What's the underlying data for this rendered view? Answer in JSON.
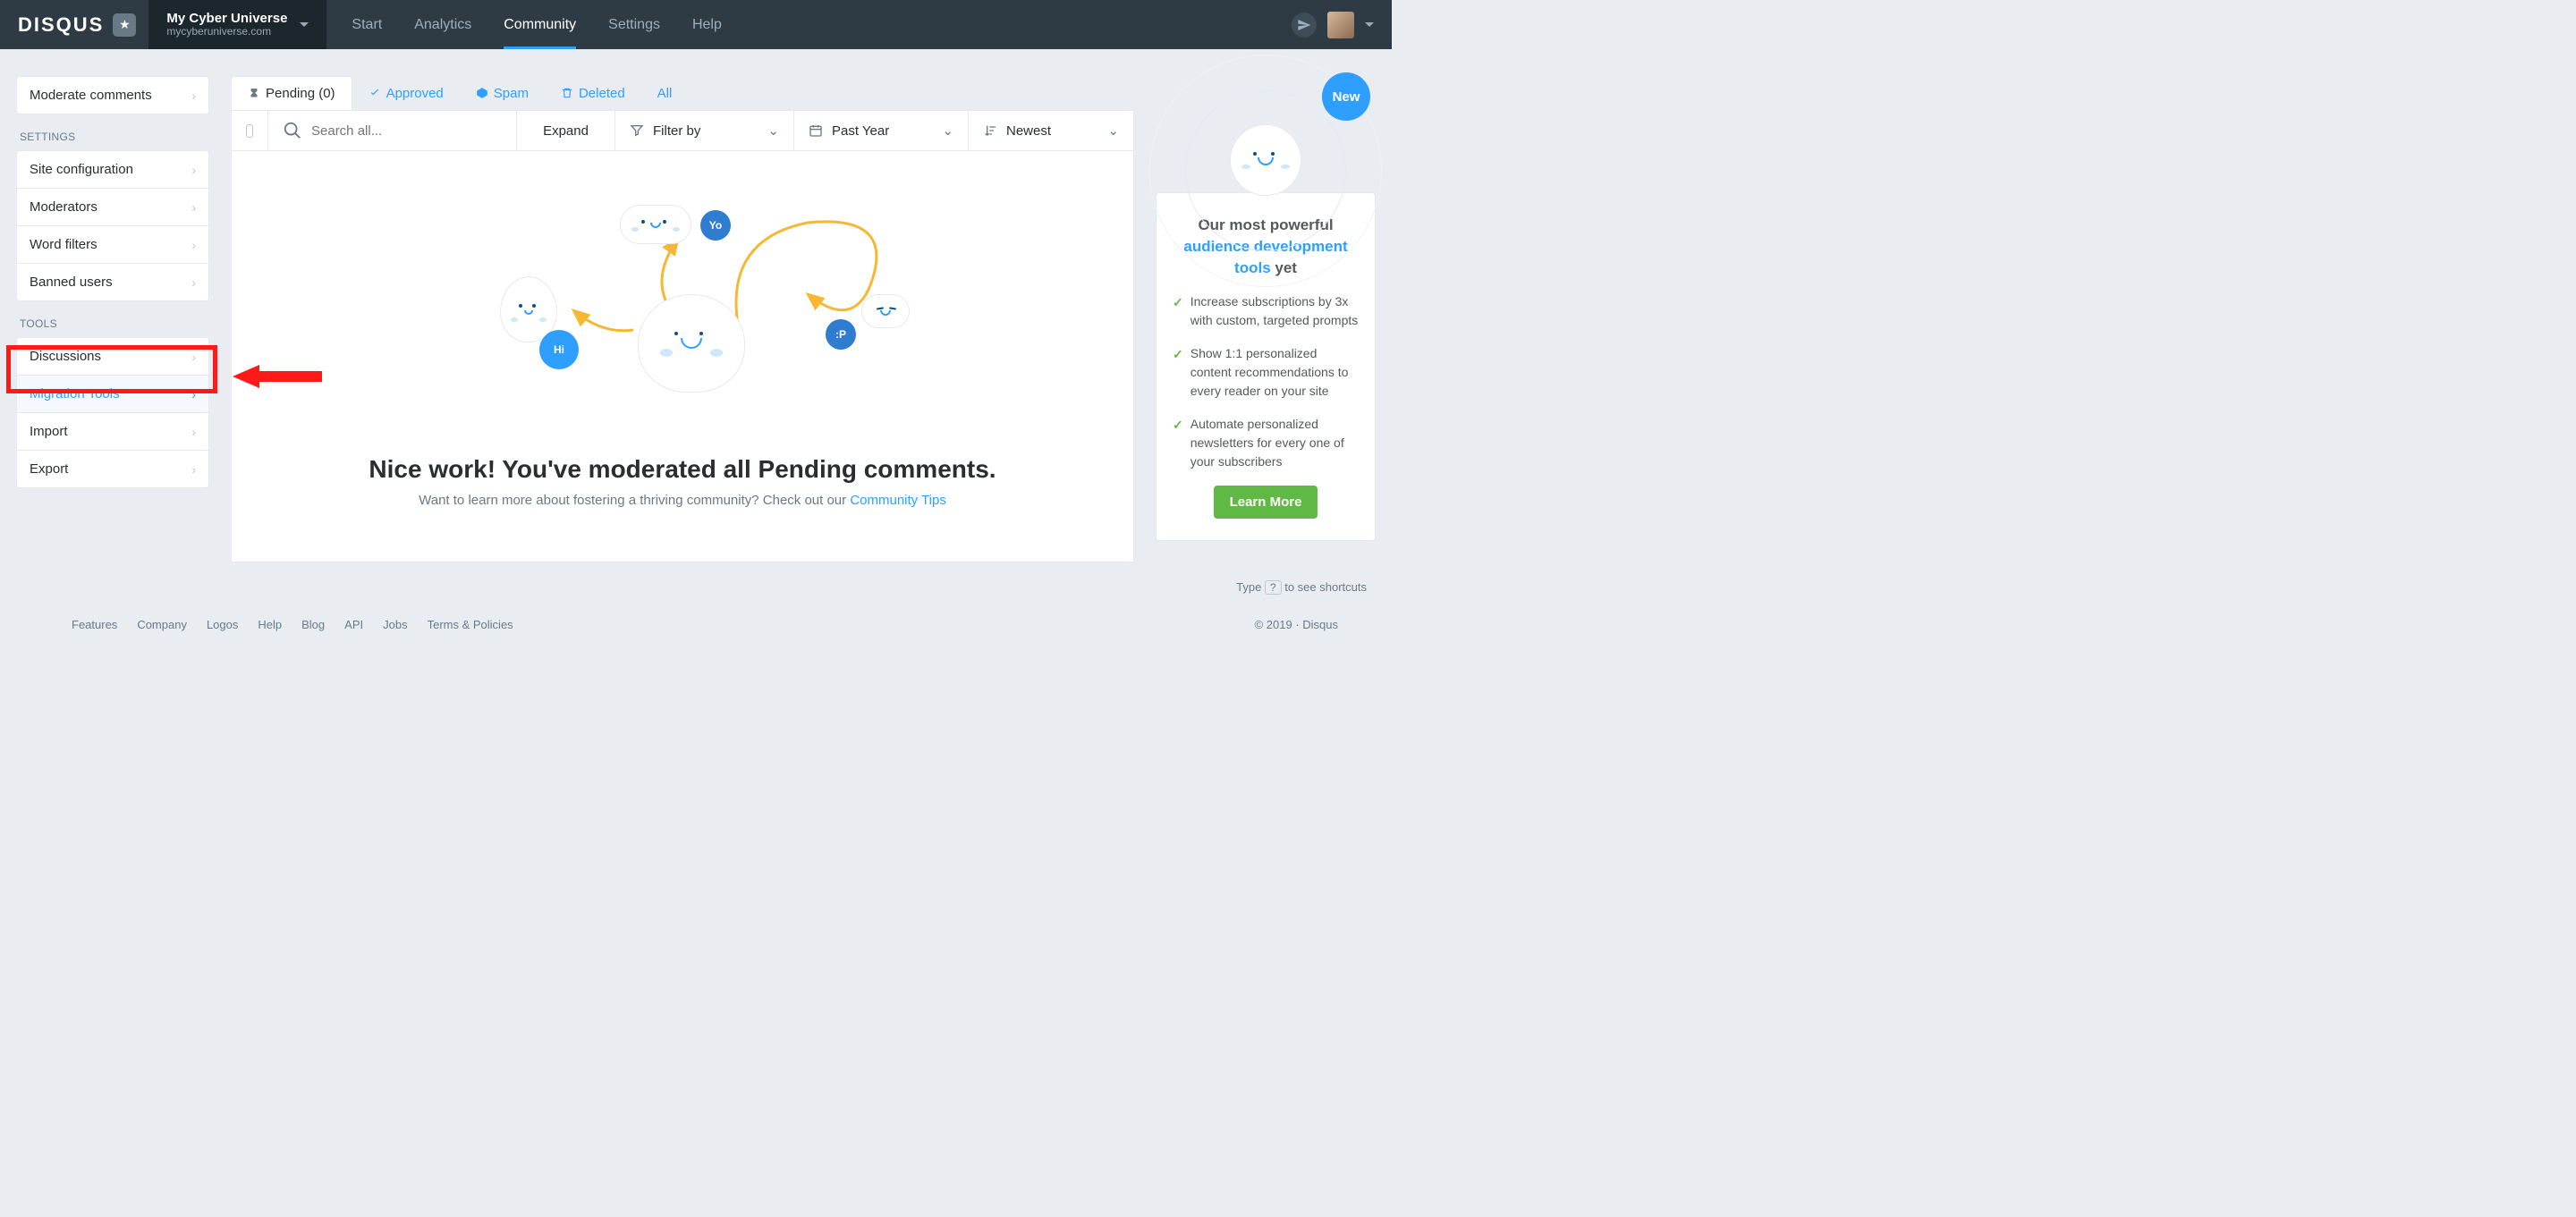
{
  "brand": "DISQUS",
  "site": {
    "title": "My Cyber Universe",
    "domain": "mycyberuniverse.com"
  },
  "topnav": {
    "start": "Start",
    "analytics": "Analytics",
    "community": "Community",
    "settings": "Settings",
    "help": "Help"
  },
  "sidebar": {
    "moderate": "Moderate comments",
    "settings_label": "SETTINGS",
    "site_config": "Site configuration",
    "moderators": "Moderators",
    "word_filters": "Word filters",
    "banned_users": "Banned users",
    "tools_label": "TOOLS",
    "discussions": "Discussions",
    "migration": "Migration Tools",
    "import": "Import",
    "export": "Export"
  },
  "modtabs": {
    "pending": "Pending (0)",
    "approved": "Approved",
    "spam": "Spam",
    "deleted": "Deleted",
    "all": "All"
  },
  "filterbar": {
    "search_placeholder": "Search all...",
    "expand": "Expand",
    "filter_by": "Filter by",
    "past_year": "Past Year",
    "newest": "Newest"
  },
  "hero": {
    "title": "Nice work! You've moderated all Pending comments.",
    "sub_pre": "Want to learn more about fostering a thriving community? Check out our ",
    "sub_link": "Community Tips"
  },
  "speech": {
    "yo": "Yo",
    "hi": "Hi",
    "p": ":P"
  },
  "promo": {
    "new": "New",
    "head_pre": "Our most powerful ",
    "head_link": "audience development tools",
    "head_post": " yet",
    "item1": "Increase subscriptions by 3x with custom, targeted prompts",
    "item2": "Show 1:1 personalized content recommendations to every reader on your site",
    "item3": "Automate personalized newsletters for every one of your subscribers",
    "learn": "Learn More"
  },
  "shortcuts": {
    "pre": "Type ",
    "key": "?",
    "post": " to see shortcuts"
  },
  "copyright": "© 2019 · Disqus",
  "footer": {
    "features": "Features",
    "company": "Company",
    "logos": "Logos",
    "help": "Help",
    "blog": "Blog",
    "api": "API",
    "jobs": "Jobs",
    "terms": "Terms & Policies"
  }
}
